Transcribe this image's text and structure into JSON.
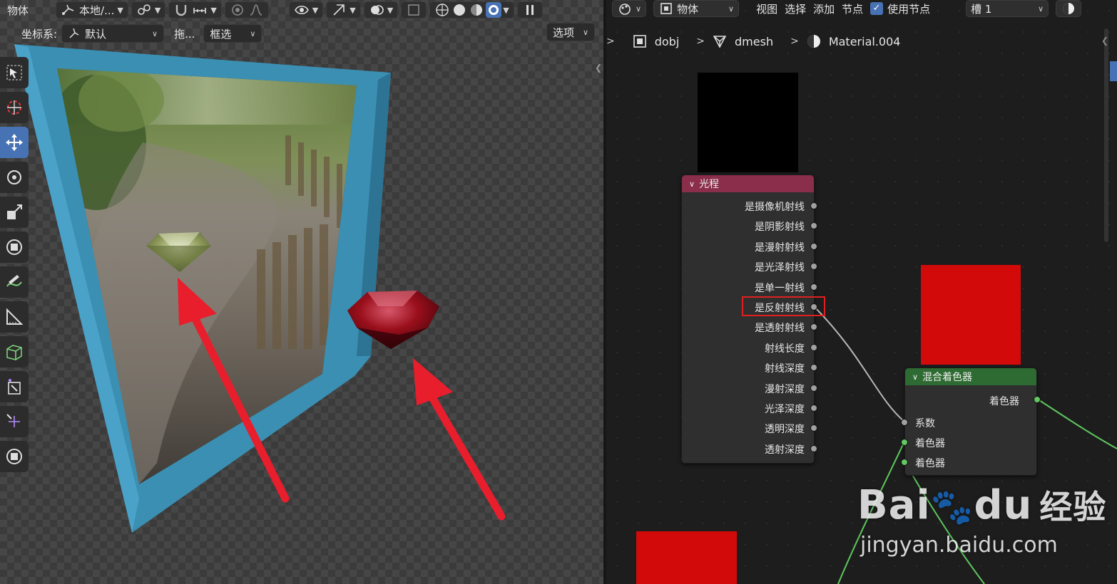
{
  "viewport": {
    "header": {
      "mode_label": "物体",
      "orientation_dropdown": "本地/...",
      "snap_icon": "snap-icon",
      "shading_icons": [
        "wireframe-shading-icon",
        "solid-shading-icon",
        "material-shading-icon",
        "rendered-shading-icon"
      ]
    },
    "toolbar_row": {
      "coord_label": "坐标系:",
      "coord_value": "默认",
      "drag_label": "拖...",
      "select_value": "框选",
      "options_label": "选项"
    },
    "tools": [
      {
        "icon": "select-box-icon",
        "active": false
      },
      {
        "icon": "cursor-icon",
        "active": false
      },
      {
        "icon": "move-icon",
        "active": true
      },
      {
        "icon": "rotate-icon",
        "active": false
      },
      {
        "icon": "scale-icon",
        "active": false
      },
      {
        "icon": "transform-icon",
        "active": false
      },
      {
        "icon": "annotate-icon",
        "active": false
      },
      {
        "icon": "measure-icon",
        "active": false
      },
      {
        "icon": "add-cube-icon",
        "active": false
      },
      {
        "icon": "extrude-icon",
        "active": false
      },
      {
        "icon": "shrink-icon",
        "active": false
      },
      {
        "icon": "transform-2-icon",
        "active": false
      }
    ]
  },
  "node_editor": {
    "header": {
      "editor_type_icon": "node-editor-icon",
      "object_dropdown": "物体",
      "menu": [
        "视图",
        "选择",
        "添加",
        "节点"
      ],
      "use_nodes_label": "使用节点",
      "use_nodes_checked": true,
      "slot_dropdown": "槽 1"
    },
    "breadcrumb": {
      "object": "dobj",
      "mesh": "dmesh",
      "material": "Material.004"
    },
    "light_path_node": {
      "title": "光程",
      "outputs": [
        "是摄像机射线",
        "是阴影射线",
        "是漫射射线",
        "是光泽射线",
        "是单一射线",
        "是反射射线",
        "是透射射线",
        "射线长度",
        "射线深度",
        "漫射深度",
        "光泽深度",
        "透明深度",
        "透射深度"
      ],
      "highlighted_output": "是反射射线"
    },
    "mix_shader_node": {
      "title": "混合着色器",
      "output": "着色器",
      "inputs": [
        "系数",
        "着色器",
        "着色器"
      ]
    },
    "colors": {
      "light_path_header": "#8a2e4b",
      "mix_shader_header": "#2e6b32",
      "highlight": "#e02020",
      "swatch_red": "#d20a0a"
    }
  },
  "watermark": {
    "brand": "Bai",
    "brand2": "du",
    "cn": "经验",
    "url": "jingyan.baidu.com"
  }
}
